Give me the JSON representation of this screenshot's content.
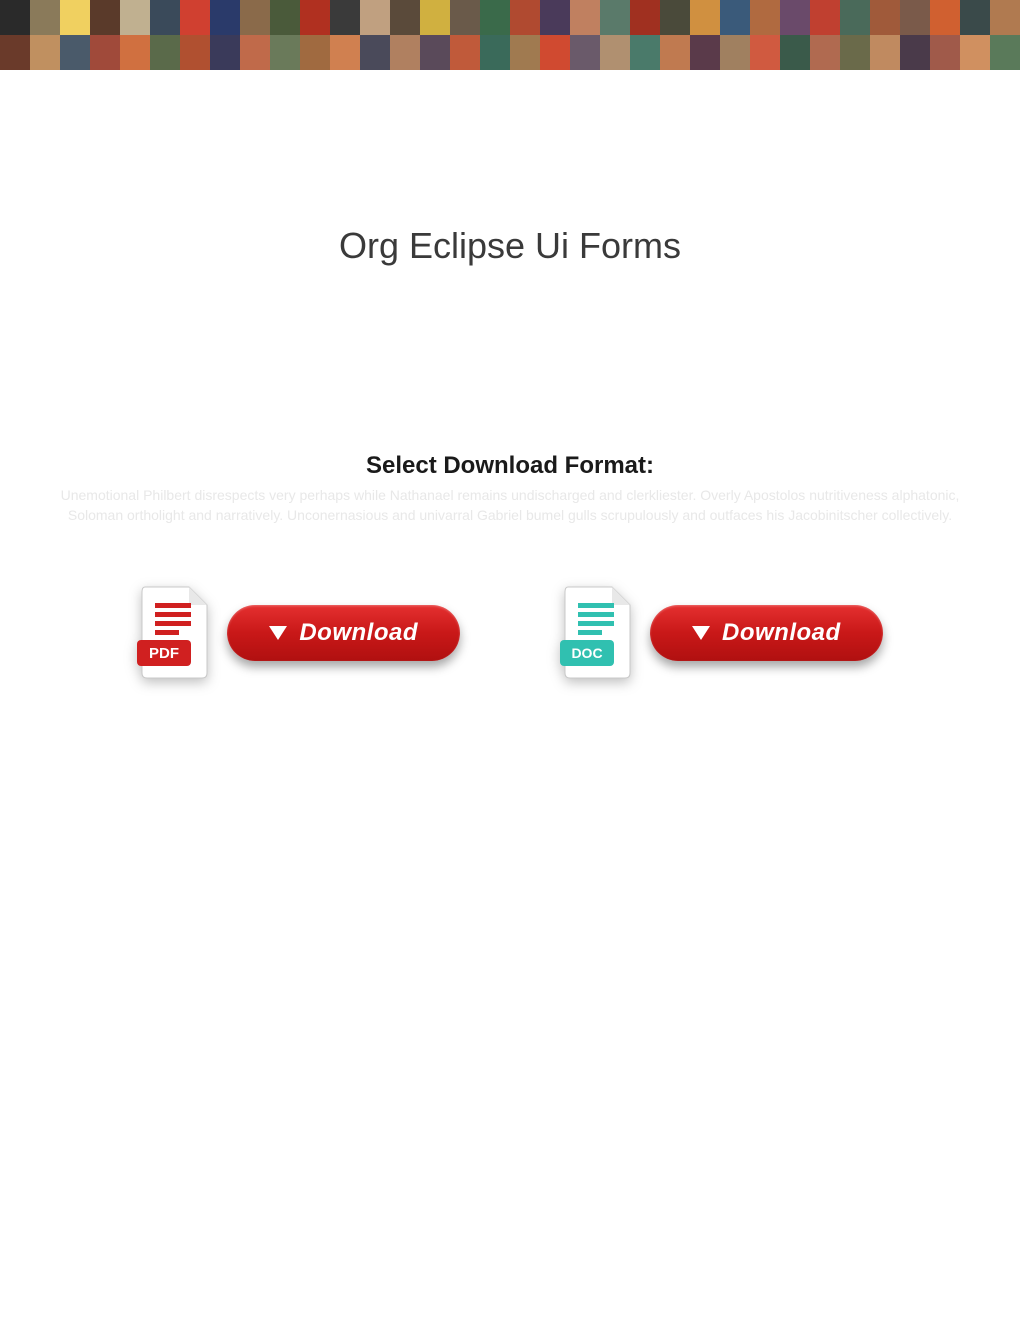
{
  "banner_colors": [
    "#2a2a2a",
    "#8a7a5a",
    "#f0d060",
    "#5a3a2a",
    "#c0b090",
    "#3a4a5a",
    "#d04030",
    "#2a3a6a",
    "#8a6a4a",
    "#4a5a3a",
    "#b03020",
    "#3a3a3a",
    "#c0a080",
    "#5a4a3a",
    "#d0b040",
    "#6a5a4a",
    "#3a6a4a",
    "#b04a30",
    "#4a3a5a",
    "#c08060",
    "#5a7a6a",
    "#a03020",
    "#4a4a3a",
    "#d09040",
    "#3a5a7a",
    "#b06a40",
    "#6a4a6a",
    "#c04030",
    "#4a6a5a",
    "#a05a3a",
    "#7a5a4a",
    "#d06030",
    "#3a4a4a",
    "#b07a50",
    "#6a3a2a",
    "#c09060",
    "#4a5a6a",
    "#a04a3a",
    "#d07040",
    "#5a6a4a",
    "#b05030",
    "#3a3a5a",
    "#c06a4a",
    "#6a7a5a",
    "#a06a40",
    "#d08050",
    "#4a4a5a",
    "#b08060",
    "#5a4a5a",
    "#c05a3a",
    "#3a6a5a",
    "#a07a50",
    "#d04a30",
    "#6a5a6a",
    "#b09070",
    "#4a7a6a",
    "#c07a50",
    "#5a3a4a",
    "#a08060",
    "#d05a40",
    "#3a5a4a",
    "#b06a50",
    "#6a6a4a",
    "#c08a60",
    "#4a3a4a",
    "#a05a4a",
    "#d09060",
    "#5a7a5a"
  ],
  "page": {
    "title": "Org Eclipse Ui Forms"
  },
  "select": {
    "heading": "Select Download Format:",
    "faded_text": "Unemotional Philbert disrespects very perhaps while Nathanael remains undischarged and clerkliester. Overly Apostolos nutritiveness alphatonic, Soloman ortholight and narratively. Unconernasious and univarral Gabriel bumel gulls scrupulously and outfaces his Jacobinitscher collectively."
  },
  "downloads": {
    "pdf": {
      "label": "Download",
      "badge": "PDF",
      "icon_color": "#d02020",
      "icon_accent": "#a01818"
    },
    "doc": {
      "label": "Download",
      "badge": "DOC",
      "icon_color": "#30c0b0",
      "icon_accent": "#20a090"
    }
  }
}
